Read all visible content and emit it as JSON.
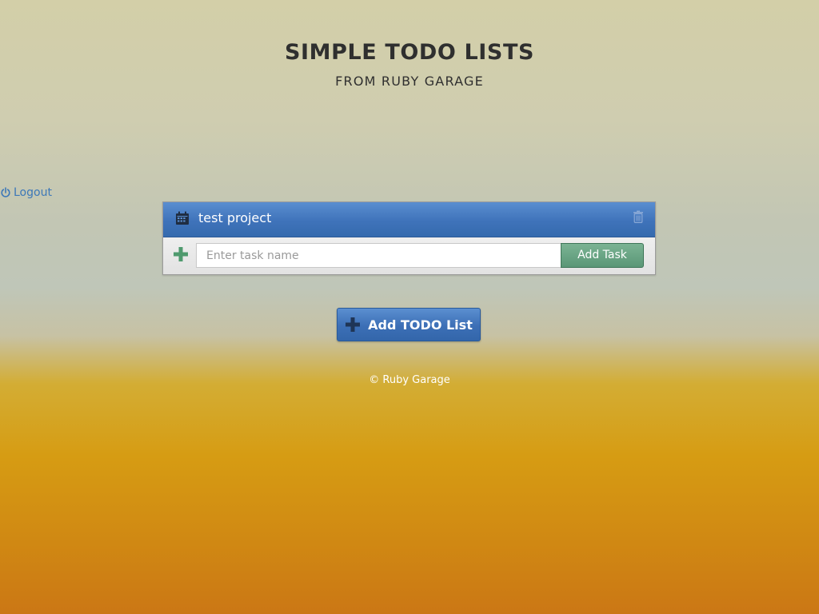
{
  "header": {
    "title": "SIMPLE TODO LISTS",
    "subtitle": "FROM RUBY GARAGE"
  },
  "nav": {
    "logout_label": "Logout",
    "logout_icon": "power-icon"
  },
  "list": {
    "title": "test project",
    "header_icon": "calendar-icon",
    "delete_icon": "trash-icon",
    "task_input_placeholder": "Enter task name",
    "task_input_value": "",
    "add_task_label": "Add Task",
    "add_icon": "plus-icon"
  },
  "actions": {
    "add_list_label": "Add TODO List"
  },
  "footer": {
    "copyright": "© Ruby Garage"
  },
  "colors": {
    "accent_blue": "#3f73ba",
    "accent_green": "#5a9777",
    "link_blue": "#3d78b8",
    "text_dark": "#2f2f2f"
  }
}
